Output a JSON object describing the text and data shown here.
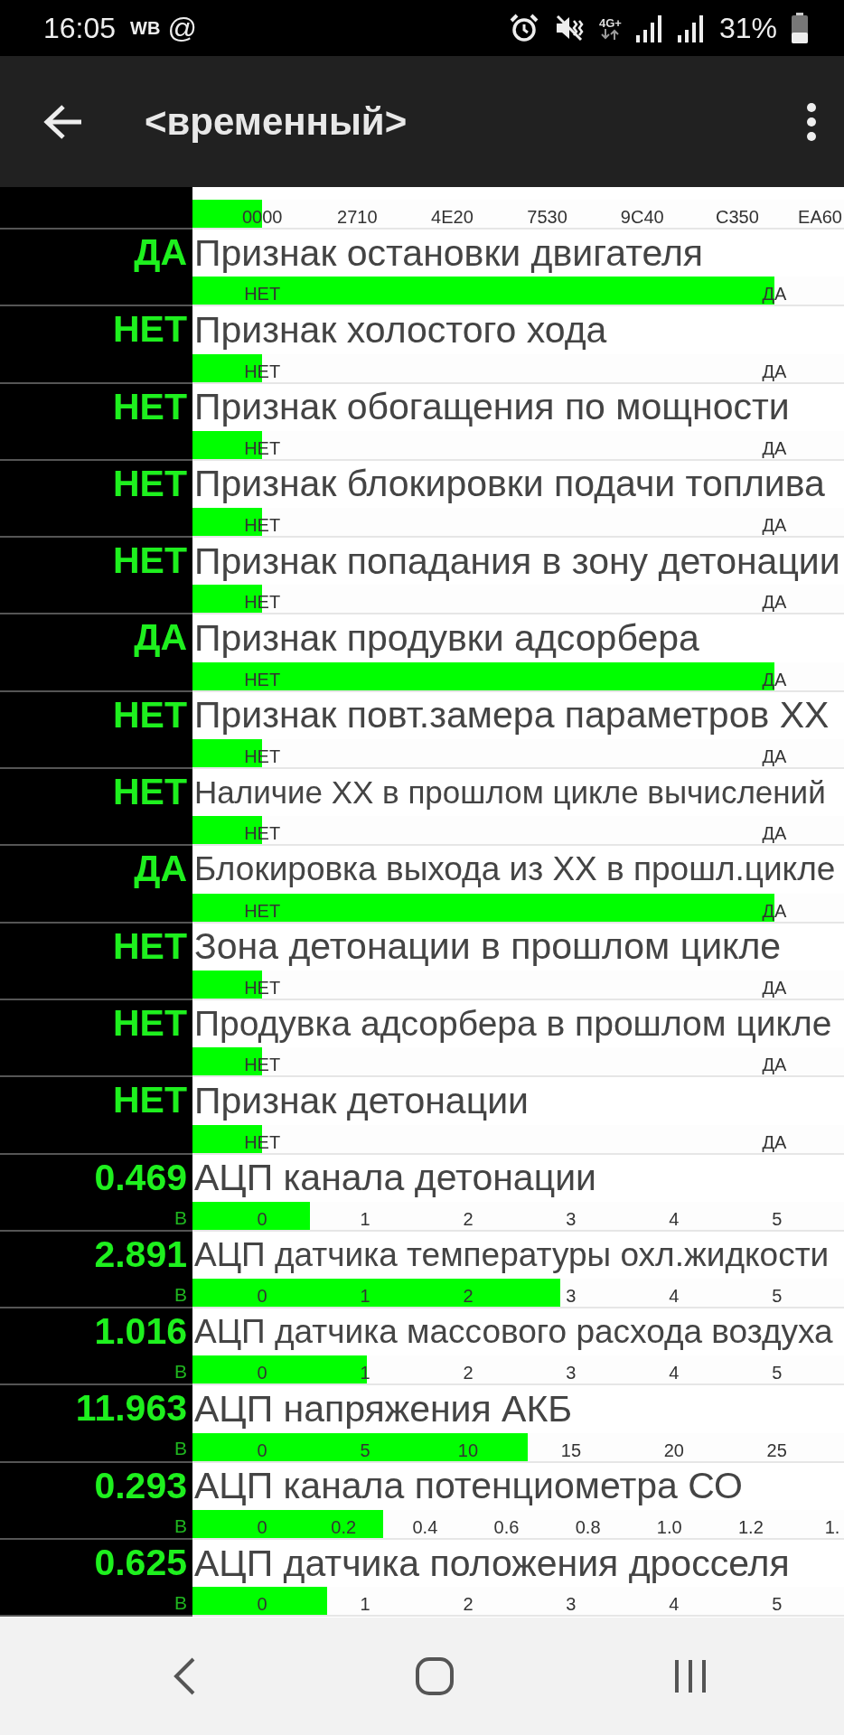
{
  "status_bar": {
    "time": "16:05",
    "carrier": "WB",
    "at_sign": "@",
    "network": "4G+",
    "battery": "31%"
  },
  "app_bar": {
    "title": "<временный>"
  },
  "rows": [
    {
      "kind": "scale_only",
      "level": 0.107,
      "scale": [
        "0000",
        "2710",
        "4E20",
        "7530",
        "9C40",
        "C350",
        "EA60"
      ]
    },
    {
      "kind": "flag",
      "value": "ДА",
      "title": "Признак остановки двигателя",
      "level": 0.893,
      "scale": [
        "НЕТ",
        "ДА"
      ]
    },
    {
      "kind": "flag",
      "value": "НЕТ",
      "title": "Признак холостого хода",
      "level": 0.107,
      "scale": [
        "НЕТ",
        "ДА"
      ]
    },
    {
      "kind": "flag",
      "value": "НЕТ",
      "title": "Признак обогащения по мощности",
      "level": 0.107,
      "scale": [
        "НЕТ",
        "ДА"
      ]
    },
    {
      "kind": "flag",
      "value": "НЕТ",
      "title": "Признак блокировки подачи топлива",
      "level": 0.107,
      "scale": [
        "НЕТ",
        "ДА"
      ]
    },
    {
      "kind": "flag",
      "value": "НЕТ",
      "title": "Признак попадания в зону детонации",
      "level": 0.107,
      "scale": [
        "НЕТ",
        "ДА"
      ]
    },
    {
      "kind": "flag",
      "value": "ДА",
      "title": "Признак продувки адсорбера",
      "level": 0.893,
      "scale": [
        "НЕТ",
        "ДА"
      ]
    },
    {
      "kind": "flag",
      "value": "НЕТ",
      "title": "Признак повт.замера параметров ХХ",
      "level": 0.107,
      "scale": [
        "НЕТ",
        "ДА"
      ]
    },
    {
      "kind": "flag",
      "value": "НЕТ",
      "title": "Наличие ХХ в прошлом цикле вычислений",
      "level": 0.107,
      "scale": [
        "НЕТ",
        "ДА"
      ]
    },
    {
      "kind": "flag",
      "value": "ДА",
      "title": "Блокировка выхода из ХХ в прошл.цикле",
      "level": 0.893,
      "scale": [
        "НЕТ",
        "ДА"
      ]
    },
    {
      "kind": "flag",
      "value": "НЕТ",
      "title": "Зона детонации в прошлом цикле",
      "level": 0.107,
      "scale": [
        "НЕТ",
        "ДА"
      ]
    },
    {
      "kind": "flag",
      "value": "НЕТ",
      "title": "Продувка адсорбера в прошлом цикле",
      "level": 0.107,
      "scale": [
        "НЕТ",
        "ДА"
      ]
    },
    {
      "kind": "flag",
      "value": "НЕТ",
      "title": "Признак детонации",
      "level": 0.107,
      "scale": [
        "НЕТ",
        "ДА"
      ]
    },
    {
      "kind": "analog",
      "value": "0.469",
      "unit": "В",
      "title": "АЦП канала детонации",
      "level": 0.18,
      "scale": [
        "0",
        "1",
        "2",
        "3",
        "4",
        "5"
      ]
    },
    {
      "kind": "analog",
      "value": "2.891",
      "unit": "В",
      "title": "АЦП датчика температуры охл.жидкости",
      "level": 0.564,
      "scale": [
        "0",
        "1",
        "2",
        "3",
        "4",
        "5"
      ]
    },
    {
      "kind": "analog",
      "value": "1.016",
      "unit": "В",
      "title": "АЦП датчика массового расхода воздуха",
      "level": 0.268,
      "scale": [
        "0",
        "1",
        "2",
        "3",
        "4",
        "5"
      ]
    },
    {
      "kind": "analog",
      "value": "11.963",
      "unit": "В",
      "title": "АЦП напряжения АКБ",
      "level": 0.514,
      "scale": [
        "0",
        "5",
        "10",
        "15",
        "20",
        "25"
      ]
    },
    {
      "kind": "analog",
      "value": "0.293",
      "unit": "В",
      "title": "АЦП канала потенциометра СО",
      "level": 0.292,
      "scale": [
        "0",
        "0.2",
        "0.4",
        "0.6",
        "0.8",
        "1.0",
        "1.2",
        "1."
      ]
    },
    {
      "kind": "analog",
      "value": "0.625",
      "unit": "В",
      "title": "АЦП датчика положения дросселя",
      "level": 0.207,
      "scale": [
        "0",
        "1",
        "2",
        "3",
        "4",
        "5"
      ]
    }
  ]
}
